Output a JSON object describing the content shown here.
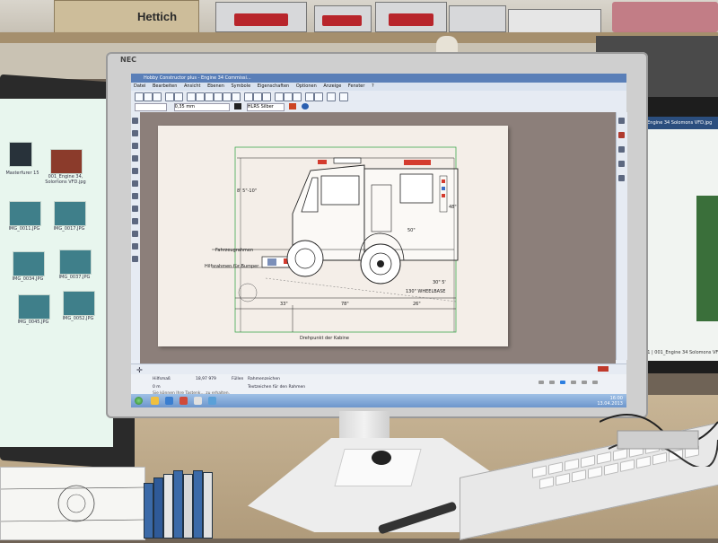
{
  "shelf": {
    "box_label": "Hettich"
  },
  "main_monitor": {
    "brand": "NEC",
    "app": {
      "title": "Hobby Constructor plus - Engine 34 Commissi...",
      "menu": [
        "Datei",
        "Bearbeiten",
        "Ansicht",
        "Ebenen",
        "Symbole",
        "Eigenschaften",
        "Optionen",
        "Anzeige",
        "Fenster",
        "?"
      ],
      "toolbar": {
        "zoom_value": "0,35 mm",
        "fill_value": "HLRS Silber"
      },
      "drawing_labels": {
        "dim_top_left": "8' 5\"-10\"",
        "label_fahrzeugrahmen": "Fahrzeugrahmen",
        "label_hilfsrahmen": "Hilfsrahmen für Bumper",
        "label_drehpunkt": "Drehpunkt der Kabine",
        "dim_bottom_1": "33\"",
        "dim_bottom_2": "78\"",
        "dim_bottom_3": "26\"",
        "dim_wheelbase": "130\" WHEELBASE",
        "dim_rear": "30\" 5'",
        "dim_right_1": "50\"",
        "dim_right_2": "48\""
      },
      "property_bar": {
        "field_1": "Hilfsmaß",
        "field_2": "0 m",
        "field_3": "Füllen",
        "field_4": "Rahmenzeichen",
        "field_5": "Textzeichen für den Rahmen",
        "field_6": "18,97 979"
      },
      "status": {
        "hint": "Sie können Ihre Tastenk... zu erhalten."
      },
      "clock": {
        "time": "16:00",
        "date": "13.04.2013"
      }
    }
  },
  "left_monitor": {
    "files": [
      {
        "name": "Masterfurer 15"
      },
      {
        "name": "001_Engine 34, Solomons VFD.jpg"
      },
      {
        "name": "IMG_0011.JPG"
      },
      {
        "name": "IMG_0017.JPG"
      },
      {
        "name": "IMG_0034.JPG"
      },
      {
        "name": "IMG_0037.JPG"
      },
      {
        "name": "IMG_0045.JPG"
      },
      {
        "name": "IMG_0052.JPG"
      }
    ]
  },
  "right_monitor": {
    "title": "001 Engine 34 Solomons VFD.jpg",
    "status": "1/201 | 001_Engine 34 Solomons VFD.jpg | 1037x4"
  }
}
